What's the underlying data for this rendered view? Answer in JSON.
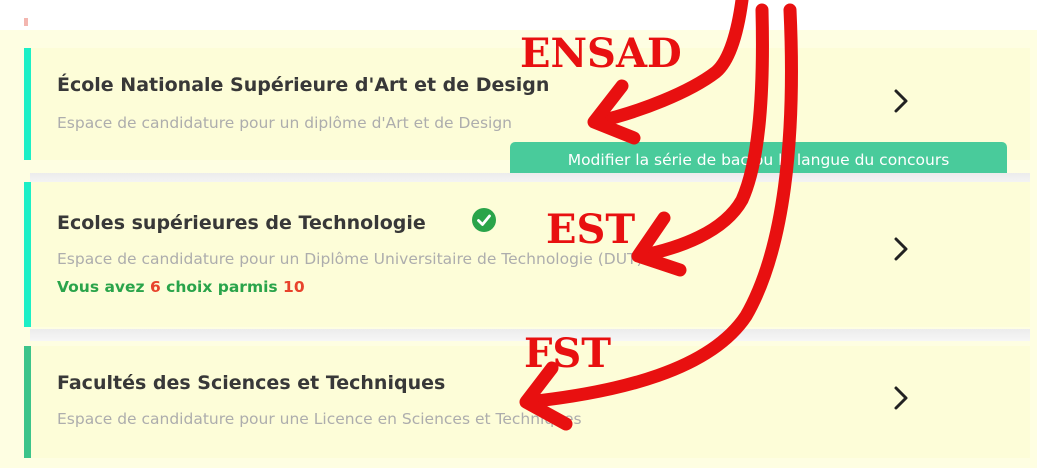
{
  "cards": [
    {
      "title": "École Nationale Supérieure d'Art et de Design",
      "subtitle": "Espace de candidature pour un diplôme d'Art et de Design",
      "accent": "#1cefc6",
      "chevron_icon": "chevron-right-icon"
    },
    {
      "title": "Ecoles supérieures de Technologie",
      "subtitle": "Espace de candidature pour un Diplôme Universitaire de Technologie (DUT)",
      "accent": "#1cefc6",
      "status_icon": "check-circle-icon",
      "status_color": "#2aa44a",
      "choices": {
        "prefix": "Vous avez",
        "selected": "6",
        "middle": "choix parmis",
        "total": "10"
      },
      "chevron_icon": "chevron-right-icon"
    },
    {
      "title": "Facultés des Sciences et Techniques",
      "subtitle": "Espace de candidature pour une Licence en Sciences et Techniques",
      "accent": "#3cc48a",
      "chevron_icon": "chevron-right-icon"
    }
  ],
  "modify_button": {
    "label": "Modifier la série de bac ou la langue du concours",
    "color": "#49cb9b"
  },
  "annotations": {
    "labels": [
      "ENSAD",
      "EST",
      "FST"
    ],
    "color": "#e81010"
  }
}
